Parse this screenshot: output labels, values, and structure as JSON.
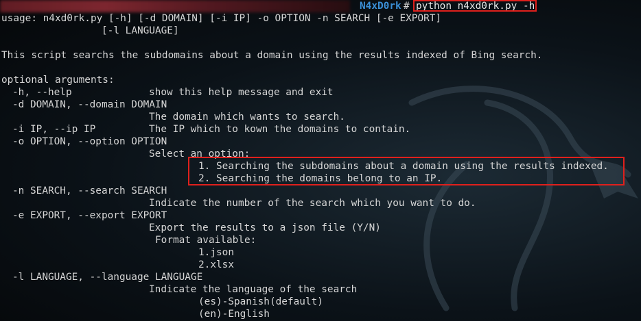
{
  "prompt": {
    "name": "N4xD0rk",
    "hash": "#",
    "command": "python n4xd0rk.py -h"
  },
  "usage": {
    "line1": "usage: n4xd0rk.py [-h] [-d DOMAIN] [-i IP] -o OPTION -n SEARCH [-e EXPORT]",
    "line2": "[-l LANGUAGE]"
  },
  "description": "This script searchs the subdomains about a domain using the results indexed of Bing search.",
  "optional_header": "optional arguments:",
  "args": {
    "help": {
      "flag": "-h, --help",
      "desc": "show this help message and exit"
    },
    "domain": {
      "flag": "-d DOMAIN, --domain DOMAIN",
      "desc": "The domain which wants to search."
    },
    "ip": {
      "flag": "-i IP, --ip IP",
      "desc": "The IP which to kown the domains to contain."
    },
    "option": {
      "flag": "-o OPTION, --option OPTION",
      "desc": "Select an option:",
      "choice1": "1. Searching the subdomains about a domain using the results indexed.",
      "choice2": "2. Searching the domains belong to an IP."
    },
    "search": {
      "flag": "-n SEARCH, --search SEARCH",
      "desc": "Indicate the number of the search which you want to do."
    },
    "export": {
      "flag": "-e EXPORT, --export EXPORT",
      "desc": "Export the results to a json file (Y/N)",
      "formats_label": "Format available:",
      "format1": "1.json",
      "format2": "2.xlsx"
    },
    "language": {
      "flag": "-l LANGUAGE, --language LANGUAGE",
      "desc": "Indicate the language of the search",
      "lang1": "(es)-Spanish(default)",
      "lang2": "(en)-English"
    }
  },
  "colors": {
    "background": "#0b1218",
    "text": "#d6d6d6",
    "prompt_name": "#3b8fd6",
    "highlight_border": "#e0201c"
  },
  "icons": {
    "background_logo": "kali-dragon-icon"
  }
}
